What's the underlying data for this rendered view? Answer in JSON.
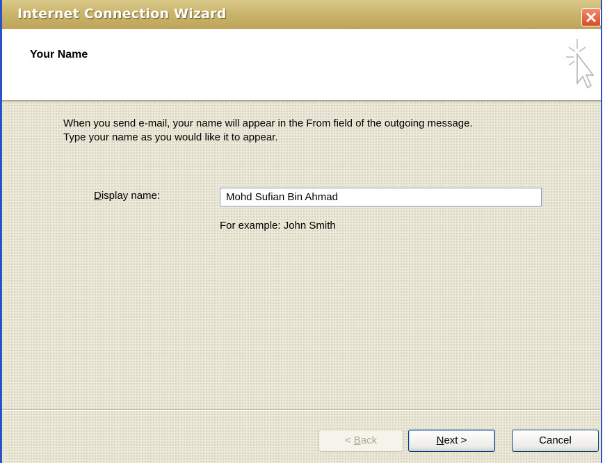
{
  "window": {
    "title": "Internet Connection Wizard",
    "close_label": "Close"
  },
  "header": {
    "title": "Your Name",
    "icon": "wizard-cursor-sparkle-icon"
  },
  "main": {
    "description_line1": "When you send e-mail, your name will appear in the From field of the outgoing message.",
    "description_line2": "Type your name as you would like it to appear.",
    "display_name_label_accel": "D",
    "display_name_label_rest": "isplay name:",
    "display_name_value": "Mohd Sufian Bin Ahmad",
    "example_text": "For example: John Smith"
  },
  "footer": {
    "back_prefix": "< ",
    "back_accel": "B",
    "back_rest": "ack",
    "next_accel": "N",
    "next_rest": "ext >",
    "cancel_label": "Cancel"
  },
  "colors": {
    "title_bar": "#cbb56b",
    "frame": "#2a52c8",
    "close_button": "#d94b25",
    "dialog_bg": "#ece9d8"
  }
}
